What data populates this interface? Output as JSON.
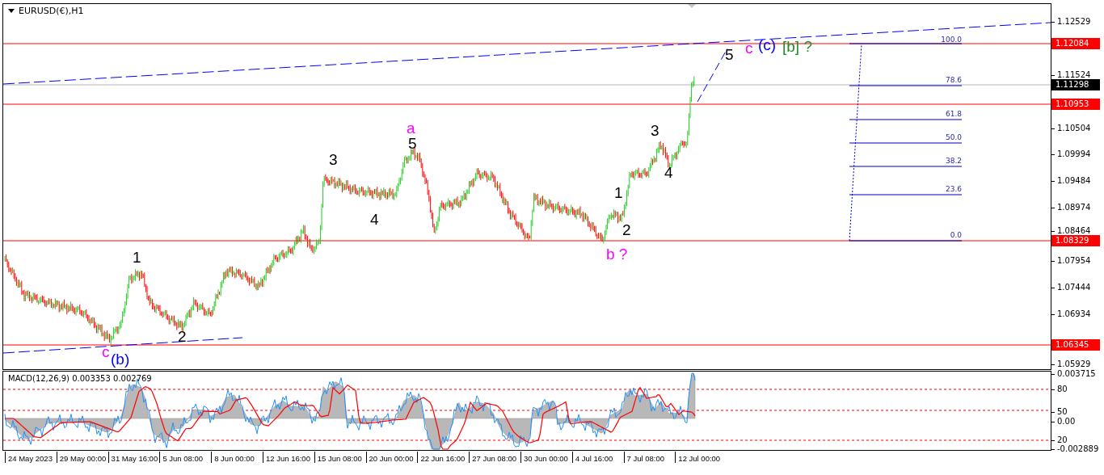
{
  "chart": {
    "title": "EURUSD(€),H1"
  },
  "price_axis": {
    "ticks": [
      "1.12529",
      "1.11524",
      "1.10504",
      "1.09994",
      "1.09484",
      "1.08974",
      "1.08464",
      "1.07954",
      "1.07444",
      "1.06934",
      "1.05929"
    ],
    "levels": [
      {
        "label": "1.12084",
        "kind": "level"
      },
      {
        "label": "1.11298",
        "kind": "current"
      },
      {
        "label": "1.10953",
        "kind": "level"
      },
      {
        "label": "1.08329",
        "kind": "level"
      },
      {
        "label": "1.06345",
        "kind": "level"
      }
    ]
  },
  "wave_labels": [
    {
      "text": "1",
      "color": "#000000"
    },
    {
      "text": "2",
      "color": "#000000"
    },
    {
      "text": "c",
      "color": "#ff00ff"
    },
    {
      "text": "(b)",
      "color": "#0000ff"
    },
    {
      "text": "3",
      "color": "#000000"
    },
    {
      "text": "4",
      "color": "#000000"
    },
    {
      "text": "a",
      "color": "#ff00ff"
    },
    {
      "text": "5",
      "color": "#000000"
    },
    {
      "text": "1",
      "color": "#000000"
    },
    {
      "text": "2",
      "color": "#000000"
    },
    {
      "text": "b ?",
      "color": "#ff00ff"
    },
    {
      "text": "3",
      "color": "#000000"
    },
    {
      "text": "4",
      "color": "#000000"
    },
    {
      "text": "5",
      "color": "#000000"
    },
    {
      "text": "c",
      "color": "#ff00ff"
    },
    {
      "text": "(c)",
      "color": "#0000ff"
    },
    {
      "text": "[b] ?",
      "color": "#228b22"
    }
  ],
  "fibonacci": {
    "levels": [
      "100.0",
      "78.6",
      "61.8",
      "50.0",
      "38.2",
      "23.6",
      "0.0"
    ]
  },
  "macd": {
    "title": "MACD(12,26,9) 0.003353 0.002769",
    "axis_labels": [
      "0.003715",
      "80",
      "50",
      "0.00",
      "20",
      "-0.002889"
    ]
  },
  "time_axis": {
    "labels": [
      "24 May 2023",
      "29 May 00:00",
      "31 May 16:00",
      "5 Jun 08:00",
      "8 Jun 00:00",
      "12 Jun 16:00",
      "15 Jun 08:00",
      "20 Jun 00:00",
      "22 Jun 16:00",
      "27 Jun 08:00",
      "30 Jun 00:00",
      "4 Jul 16:00",
      "7 Jul 08:00",
      "12 Jul 00:00"
    ]
  }
}
